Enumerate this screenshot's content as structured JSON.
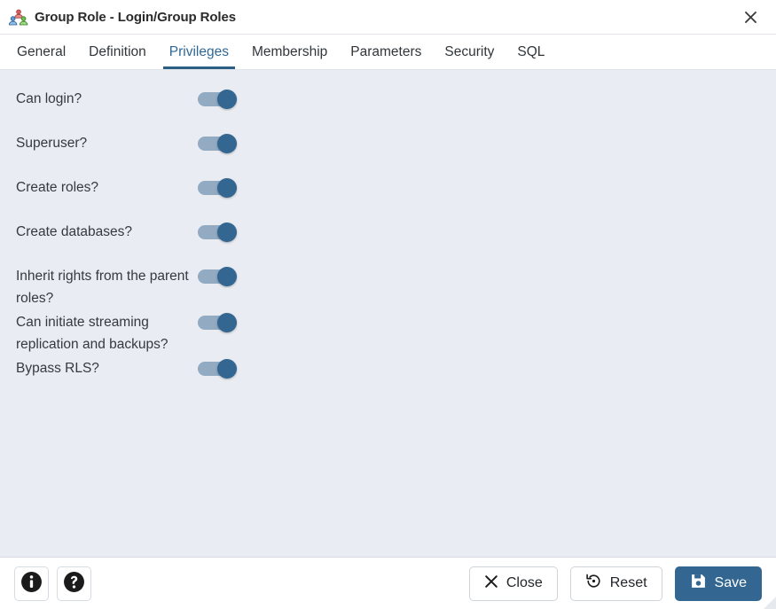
{
  "window": {
    "title": "Group Role - Login/Group Roles",
    "icon": "group-role-icon",
    "close_icon": "close-icon",
    "accent_color": "#336791",
    "content_background": "#e9ecf2",
    "active_tab_color": "#2f6896"
  },
  "tabs": [
    {
      "label": "General",
      "active": false
    },
    {
      "label": "Definition",
      "active": false
    },
    {
      "label": "Privileges",
      "active": true
    },
    {
      "label": "Membership",
      "active": false
    },
    {
      "label": "Parameters",
      "active": false
    },
    {
      "label": "Security",
      "active": false
    },
    {
      "label": "SQL",
      "active": false
    }
  ],
  "privileges": [
    {
      "label": "Can login?",
      "value": true,
      "state_text": "On"
    },
    {
      "label": "Superuser?",
      "value": true,
      "state_text": "On"
    },
    {
      "label": "Create roles?",
      "value": true,
      "state_text": "On"
    },
    {
      "label": "Create databases?",
      "value": true,
      "state_text": "On"
    },
    {
      "label": "Inherit rights from the parent roles?",
      "value": true,
      "state_text": "On"
    },
    {
      "label": "Can initiate streaming replication and backups?",
      "value": true,
      "state_text": "On"
    },
    {
      "label": "Bypass RLS?",
      "value": true,
      "state_text": "On"
    }
  ],
  "footer": {
    "info_label": "Information",
    "help_label": "Help",
    "close_label": "Close",
    "reset_label": "Reset",
    "save_label": "Save"
  }
}
